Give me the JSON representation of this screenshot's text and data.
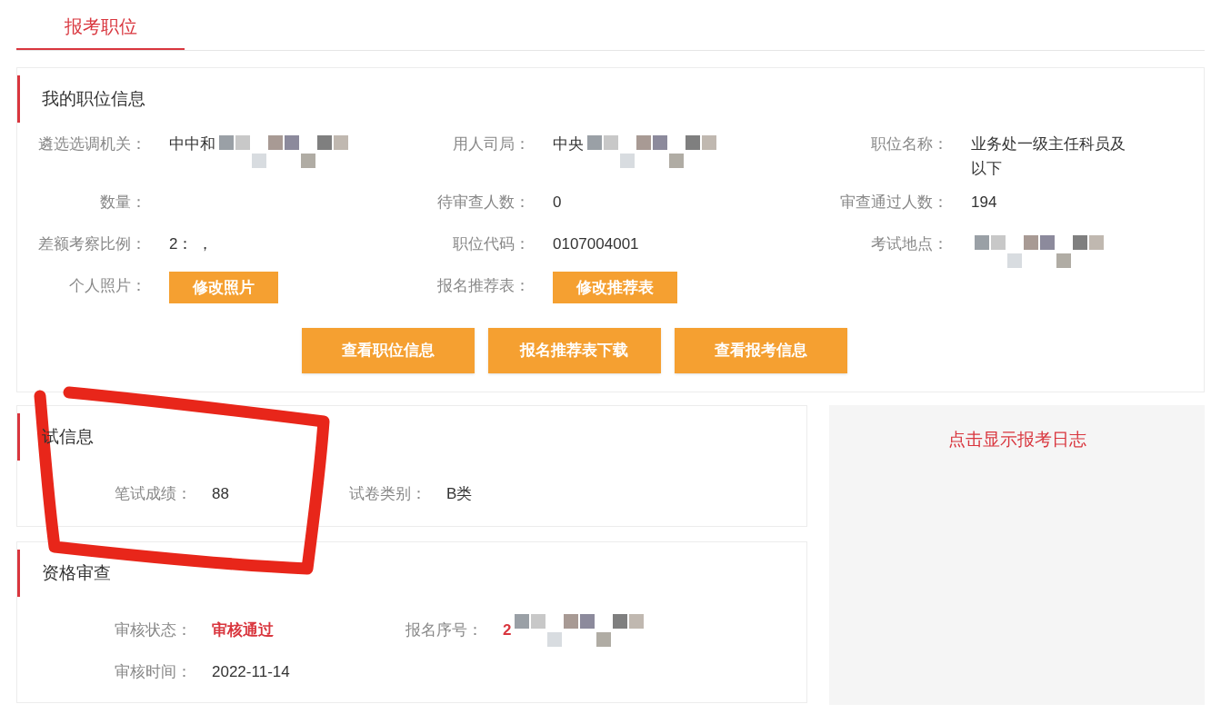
{
  "tabs": [
    {
      "label": "报考职位",
      "selected": true
    }
  ],
  "position_info": {
    "title": "我的职位信息",
    "rows": [
      [
        {
          "label": "遴选选调机关：",
          "value": "中中和",
          "redacted": true
        },
        {
          "label": "用人司局：",
          "value": "中央",
          "redacted": true
        },
        {
          "label": "职位名称：",
          "value": "业务处一级主任科员及以下"
        }
      ],
      [
        {
          "label": "数量："
        },
        {
          "label": "待审查人数：",
          "value": "0"
        },
        {
          "label": "审查通过人数：",
          "value": "194"
        }
      ],
      [
        {
          "label": "差额考察比例：",
          "value": "2： ，"
        },
        {
          "label": "职位代码：",
          "value": "0107004001"
        },
        {
          "label": "考试地点：",
          "redacted": true
        }
      ],
      [
        {
          "label": "个人照片：",
          "button": "修改照片"
        },
        {
          "label": "报名推荐表：",
          "button": "修改推荐表"
        }
      ]
    ],
    "actions": [
      "查看职位信息",
      "报名推荐表下载",
      "查看报考信息"
    ]
  },
  "written_exam": {
    "title": "试信息",
    "fields": [
      {
        "label": "笔试成绩：",
        "value": "88"
      },
      {
        "label": "试卷类别：",
        "value": "B类"
      }
    ]
  },
  "qualification": {
    "title": "资格审查",
    "fields": [
      {
        "label": "审核状态：",
        "value": "审核通过",
        "kind": "status"
      },
      {
        "label": "报名序号：",
        "value": "2",
        "kind": "status",
        "redacted": true
      },
      {
        "label": "审核时间：",
        "value": "2022-11-14",
        "kind": "text"
      }
    ]
  },
  "log_panel": {
    "link": "点击显示报考日志"
  }
}
